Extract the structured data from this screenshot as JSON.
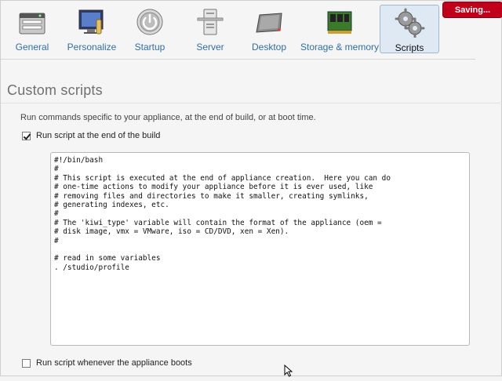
{
  "status_badge": "Saving...",
  "toolbar": {
    "items": [
      {
        "label": "General",
        "icon": "appliance-icon"
      },
      {
        "label": "Personalize",
        "icon": "monitor-brush-icon"
      },
      {
        "label": "Startup",
        "icon": "power-icon"
      },
      {
        "label": "Server",
        "icon": "server-tower-icon"
      },
      {
        "label": "Desktop",
        "icon": "desktop-pad-icon"
      },
      {
        "label": "Storage & memory",
        "icon": "memory-chip-icon"
      },
      {
        "label": "Scripts",
        "icon": "gears-icon",
        "active": true
      }
    ]
  },
  "section": {
    "title": "Custom scripts",
    "description": "Run commands specific to your appliance, at the end of build, or at boot time."
  },
  "build_script": {
    "checkbox_label": "Run script at the end of the build",
    "checked": true,
    "lines": [
      "#!/bin/bash",
      "#",
      "# This script is executed at the end of appliance creation.  Here you can do",
      "# one-time actions to modify your appliance before it is ever used, like",
      "# removing files and directories to make it smaller, creating symlinks,",
      "# generating indexes, etc.",
      "#",
      "# The 'kiwi_type' variable will contain the format of the appliance (oem =",
      "# disk image, vmx = VMware, iso = CD/DVD, xen = Xen).",
      "#",
      "",
      "# read in some variables",
      ". /studio/profile"
    ]
  },
  "boot_script": {
    "checkbox_label": "Run script whenever the appliance boots",
    "checked": false
  },
  "colors": {
    "link": "#2f6fa8",
    "active_tab_bg": "#dfe9f3",
    "saving_bg": "#c1001a"
  }
}
